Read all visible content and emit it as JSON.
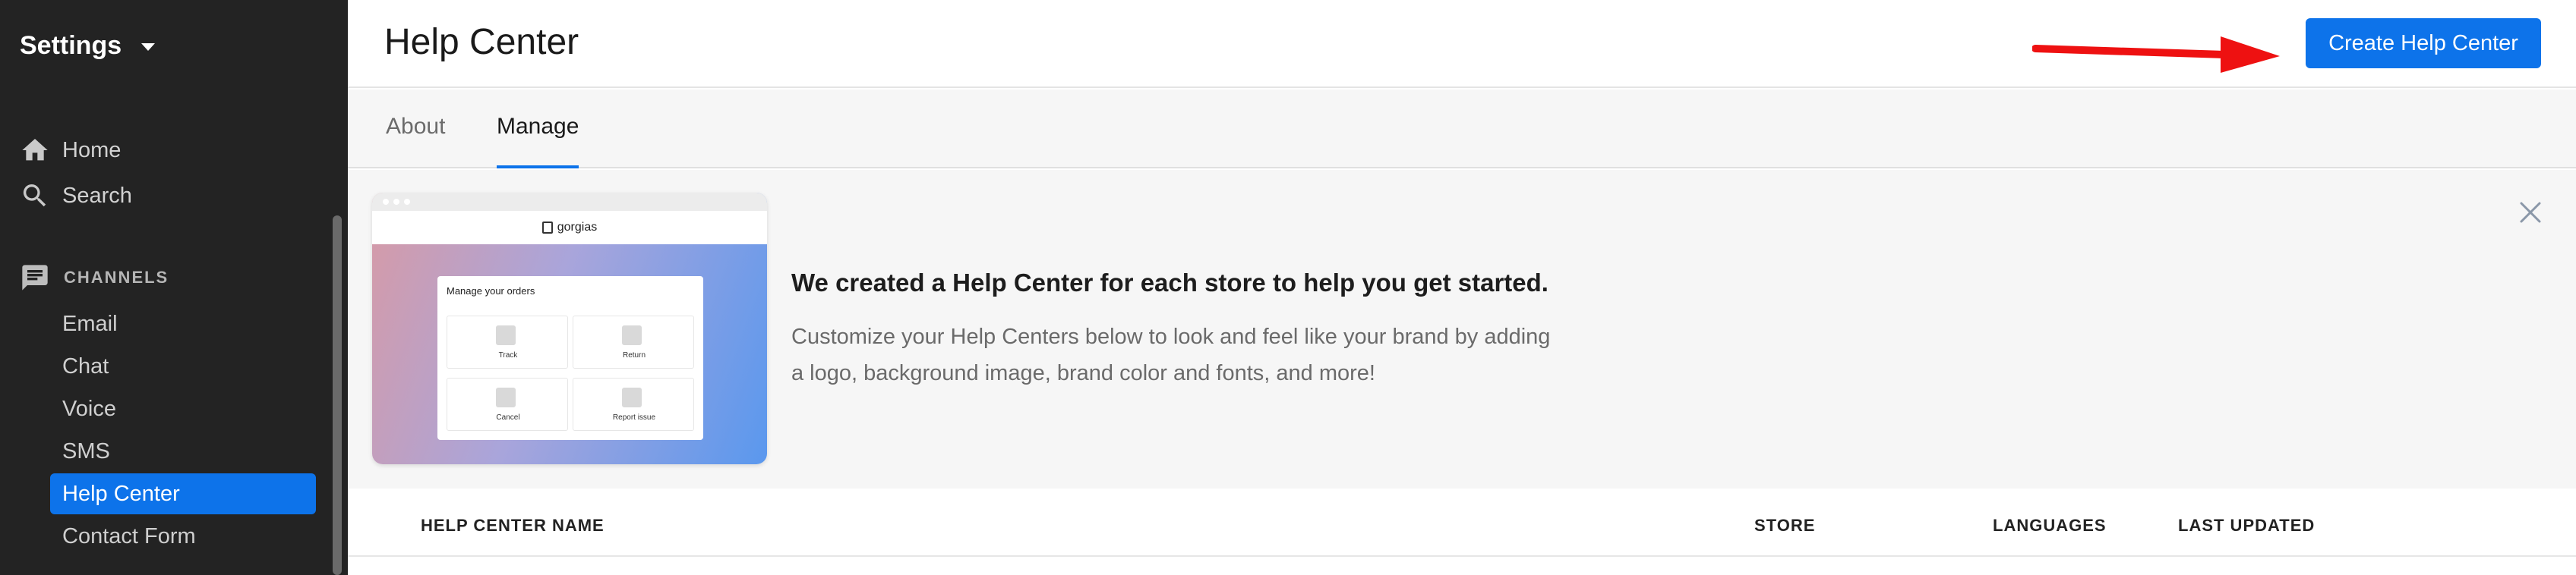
{
  "sidebar": {
    "title": "Settings",
    "nav": [
      {
        "label": "Home",
        "icon": "home-icon"
      },
      {
        "label": "Search",
        "icon": "search-icon"
      }
    ],
    "section_label": "CHANNELS",
    "section_icon": "chat-bubble-icon",
    "channels": [
      {
        "label": "Email",
        "active": false
      },
      {
        "label": "Chat",
        "active": false
      },
      {
        "label": "Voice",
        "active": false
      },
      {
        "label": "SMS",
        "active": false
      },
      {
        "label": "Help Center",
        "active": true
      },
      {
        "label": "Contact Form",
        "active": false
      }
    ]
  },
  "header": {
    "title": "Help Center",
    "create_button": "Create Help Center",
    "annotation": "red-arrow-pointing-right"
  },
  "tabs": [
    {
      "label": "About",
      "active": false
    },
    {
      "label": "Manage",
      "active": true
    }
  ],
  "banner": {
    "title": "We created a Help Center for each store to help you get started.",
    "description": "Customize your Help Centers below to look and feel like your brand by adding a logo, background image, brand color and fonts, and more!",
    "preview": {
      "brand": "gorgias",
      "card_title": "Manage your orders",
      "tiles": [
        "Track",
        "Return",
        "Cancel",
        "Report issue"
      ]
    }
  },
  "table": {
    "columns": [
      "HELP CENTER NAME",
      "STORE",
      "LANGUAGES",
      "LAST UPDATED"
    ]
  },
  "colors": {
    "accent": "#0d73ea",
    "sidebar_bg": "#232323",
    "annotation_arrow": "#ee1111"
  }
}
